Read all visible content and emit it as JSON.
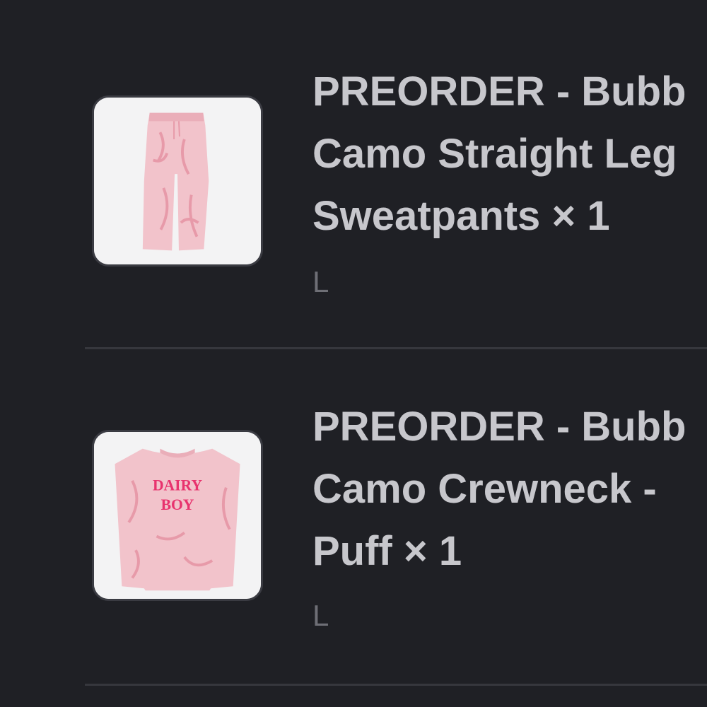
{
  "order_items": [
    {
      "title_lines": [
        "PREORDER - Bubb",
        "Camo Straight Leg",
        "Sweatpants × 1"
      ],
      "variant": "L",
      "image_icon": "pink-sweatpants-image"
    },
    {
      "title_lines": [
        "PREORDER - Bubb",
        "Camo Crewneck -",
        "Puff × 1"
      ],
      "variant": "L",
      "image_icon": "pink-crewneck-image",
      "image_text": [
        "DAIRY",
        "BOY"
      ]
    }
  ],
  "colors": {
    "background": "#1f2025",
    "title": "#c7c7cc",
    "variant": "#6e6f76",
    "divider": "#36373d",
    "accent_pink": "#e8336e"
  }
}
